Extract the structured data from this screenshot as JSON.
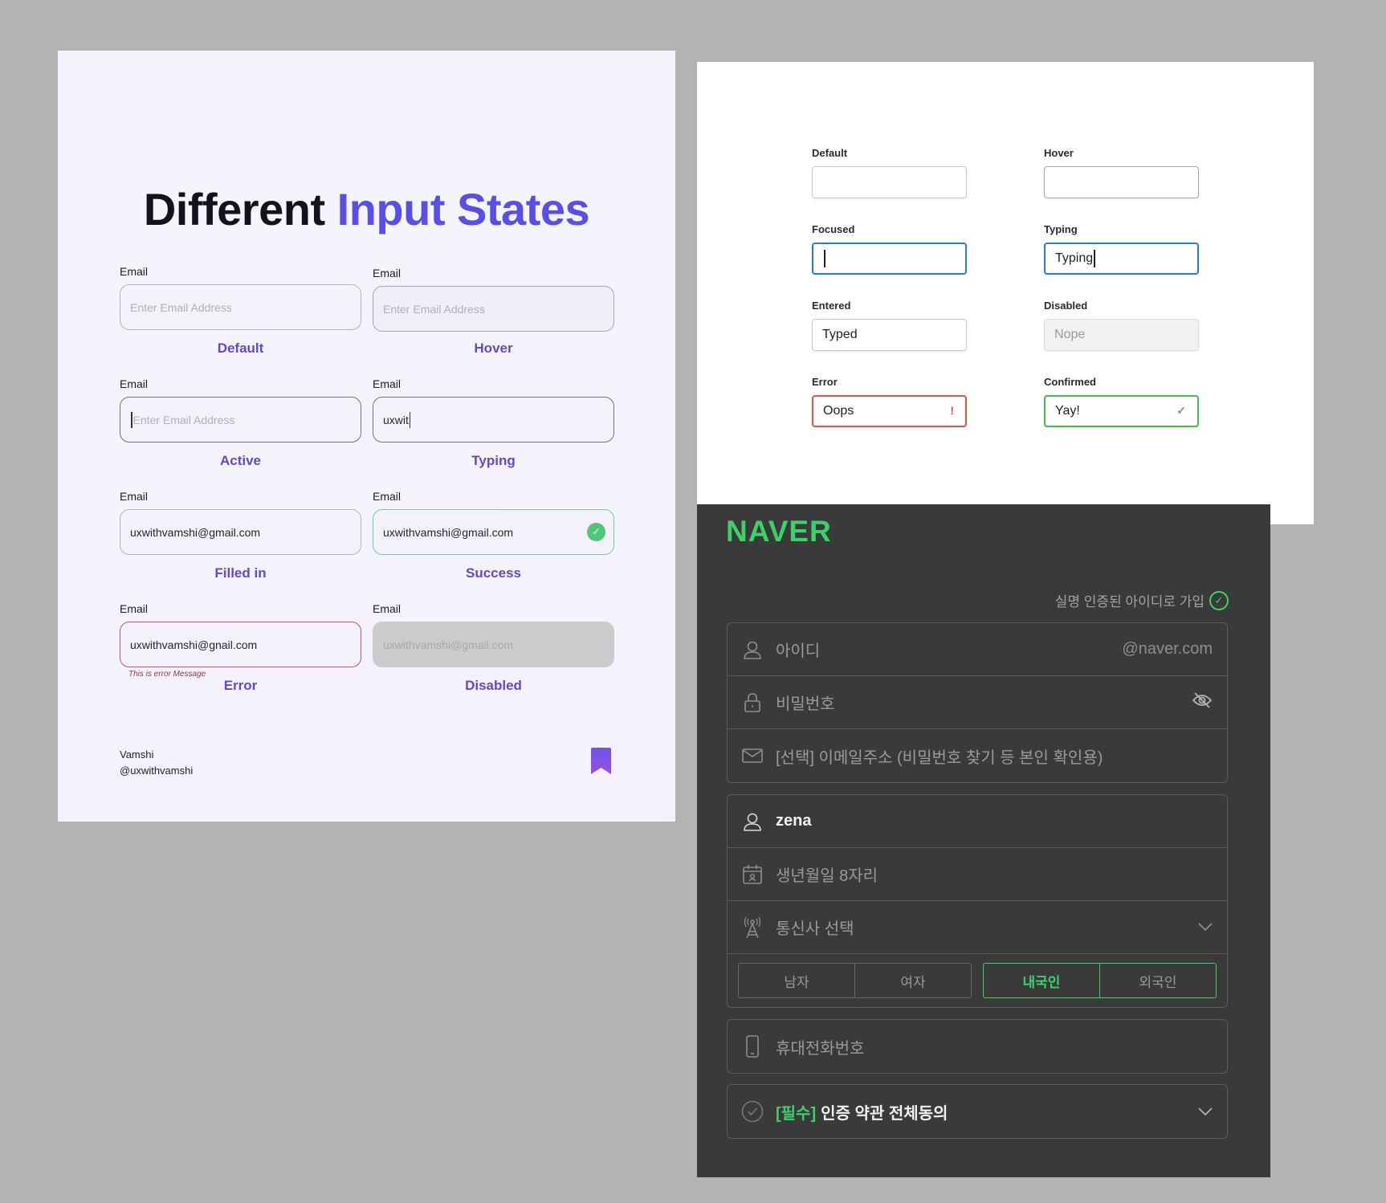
{
  "card1": {
    "title_part1": "Different",
    "title_part2": "Input States",
    "accent": "#5a4ee8",
    "fields": [
      {
        "label": "Email",
        "value": "Enter Email Address",
        "state": "Default"
      },
      {
        "label": "Email",
        "value": "Enter Email Address",
        "state": "Hover"
      },
      {
        "label": "Email",
        "value": "Enter Email Address",
        "state": "Active"
      },
      {
        "label": "Email",
        "value": "uxwit",
        "state": "Typing"
      },
      {
        "label": "Email",
        "value": "uxwithvamshi@gmail.com",
        "state": "Filled in"
      },
      {
        "label": "Email",
        "value": "uxwithvamshi@gmail.com",
        "state": "Success",
        "icon": "check-circle-icon"
      },
      {
        "label": "Email",
        "value": "uxwithvamshi@gnail.com",
        "state": "Error",
        "error_message": "This is error Message"
      },
      {
        "label": "Email",
        "value": "uxwithvamshi@gmail.com",
        "state": "Disabled"
      }
    ],
    "author_name": "Vamshi",
    "author_handle": "@uxwithvamshi",
    "bookmark_icon": "bookmark-icon"
  },
  "card2": {
    "fields": [
      {
        "label": "Default",
        "value": ""
      },
      {
        "label": "Hover",
        "value": ""
      },
      {
        "label": "Focused",
        "value": ""
      },
      {
        "label": "Typing",
        "value": "Typing"
      },
      {
        "label": "Entered",
        "value": "Typed"
      },
      {
        "label": "Disabled",
        "value": "Nope"
      },
      {
        "label": "Error",
        "value": "Oops",
        "mark": "!"
      },
      {
        "label": "Confirmed",
        "value": "Yay!",
        "mark": "✓"
      }
    ],
    "focus_color": "#2f78d6",
    "error_color": "#d9534f",
    "confirm_color": "#4ab950"
  },
  "card3": {
    "logo": "NAVER",
    "brand_color": "#3dd16a",
    "verified_text": "실명 인증된 아이디로 가입",
    "id_placeholder": "아이디",
    "id_suffix": "@naver.com",
    "password_placeholder": "비밀번호",
    "email_placeholder": "[선택] 이메일주소 (비밀번호 찾기 등 본인 확인용)",
    "name_value": "zena",
    "birth_placeholder": "생년월일 8자리",
    "carrier_placeholder": "통신사 선택",
    "gender": [
      "남자",
      "여자"
    ],
    "nationality": [
      "내국인",
      "외국인"
    ],
    "nationality_selected": "내국인",
    "phone_placeholder": "휴대전화번호",
    "agree_required": "[필수]",
    "agree_text": "인증 약관 전체동의"
  }
}
